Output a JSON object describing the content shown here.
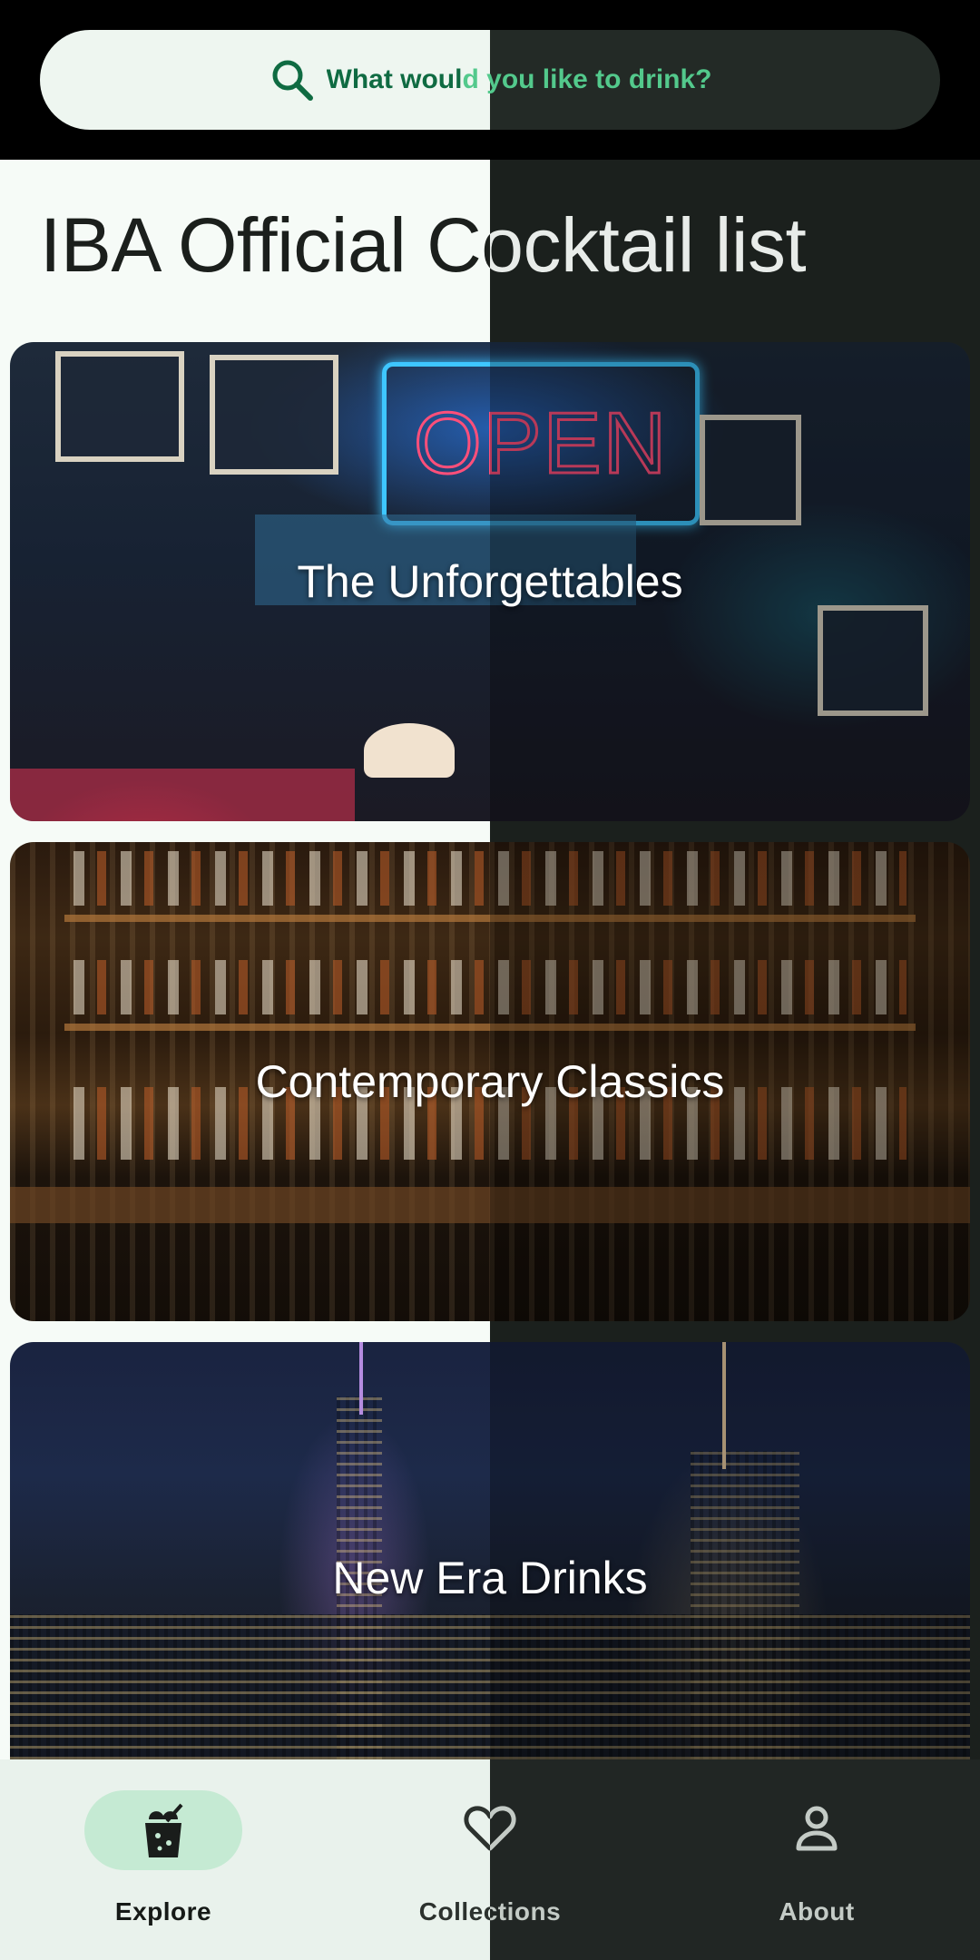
{
  "search": {
    "placeholder": "What would you like to drink?",
    "icon": "search-icon",
    "accent": "#1a7a4f"
  },
  "page": {
    "title": "IBA Official Cocktail list"
  },
  "categories": [
    {
      "label": "The Unforgettables",
      "image": "bar-with-neon-open-sign"
    },
    {
      "label": "Contemporary Classics",
      "image": "bar-shelves-with-bottles"
    },
    {
      "label": "New Era Drinks",
      "image": "night-city-skyline"
    }
  ],
  "bottom_nav": {
    "items": [
      {
        "label": "Explore",
        "icon": "cocktail-icon",
        "selected": true
      },
      {
        "label": "Collections",
        "icon": "heart-icon",
        "selected": false
      },
      {
        "label": "About",
        "icon": "person-icon",
        "selected": false
      }
    ],
    "selected_color": "#c5ead3"
  }
}
